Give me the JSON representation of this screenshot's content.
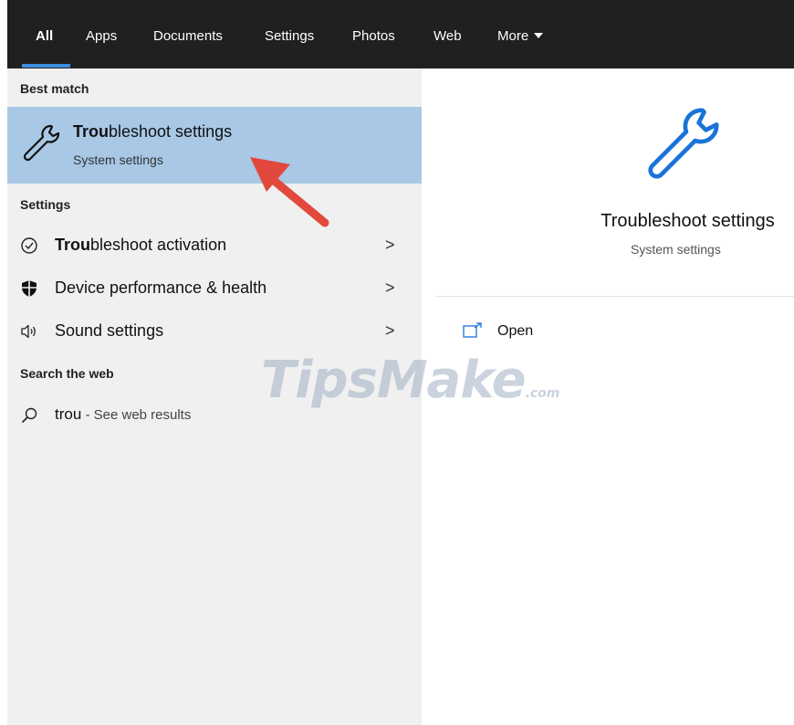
{
  "tabs": [
    {
      "label": "All",
      "active": true
    },
    {
      "label": "Apps"
    },
    {
      "label": "Documents"
    },
    {
      "label": "Settings"
    },
    {
      "label": "Photos"
    },
    {
      "label": "Web"
    },
    {
      "label": "More"
    }
  ],
  "left": {
    "best_match_header": "Best match",
    "best_match": {
      "title_bold": "Trou",
      "title_rest": "bleshoot settings",
      "subtitle": "System settings",
      "icon": "wrench-icon"
    },
    "settings_header": "Settings",
    "settings_items": [
      {
        "bold": "Trou",
        "rest": "bleshoot activation",
        "icon": "check-circle-icon"
      },
      {
        "bold": "",
        "rest": "Device performance & health",
        "icon": "shield-icon"
      },
      {
        "bold": "",
        "rest": "Sound settings",
        "icon": "speaker-icon"
      }
    ],
    "web_header": "Search the web",
    "web_item": {
      "query": "trou",
      "suffix": " - See web results",
      "icon": "search-icon"
    }
  },
  "right": {
    "title": "Troubleshoot settings",
    "subtitle": "System settings",
    "actions": [
      {
        "label": "Open",
        "icon": "open-window-icon"
      }
    ]
  },
  "watermark": {
    "main": "TipsMake",
    "suffix": ".com"
  },
  "colors": {
    "accent": "#1a73d9",
    "selection": "#a8c8e6",
    "annotation_arrow": "#e2483c",
    "topbar": "#202020"
  }
}
